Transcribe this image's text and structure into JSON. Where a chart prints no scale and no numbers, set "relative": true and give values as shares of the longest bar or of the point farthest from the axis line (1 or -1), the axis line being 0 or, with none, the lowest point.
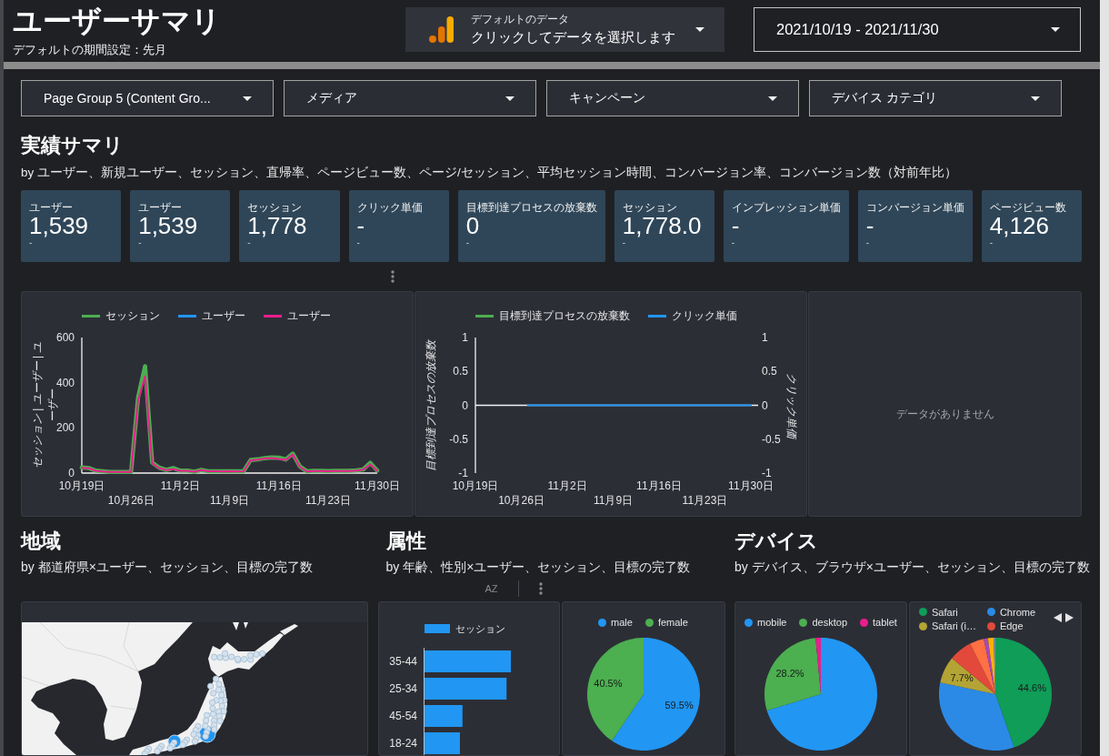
{
  "header": {
    "title": "ユーザーサマリ",
    "subtitle": "デフォルトの期間設定：先月",
    "data_source": {
      "caption": "デフォルトのデータ",
      "label": "クリックしてデータを選択します"
    },
    "date_range": "2021/10/19 - 2021/11/30"
  },
  "filters": [
    {
      "label": "Page Group 5 (Content Gro..."
    },
    {
      "label": "メディア"
    },
    {
      "label": "キャンペーン"
    },
    {
      "label": "デバイス カテゴリ"
    }
  ],
  "summary": {
    "title": "実績サマリ",
    "subtitle": "by ユーザー、新規ユーザー、セッション、直帰率、ページビュー数、ページ/セッション、平均セッション時間、コンバージョン率、コンバージョン数（対前年比）",
    "cards": [
      {
        "label": "ユーザー",
        "value": "1,539",
        "change": "-"
      },
      {
        "label": "ユーザー",
        "value": "1,539",
        "change": "-"
      },
      {
        "label": "セッション",
        "value": "1,778",
        "change": "-"
      },
      {
        "label": "クリック単価",
        "value": "-",
        "change": "-"
      },
      {
        "label": "目標到達プロセスの放棄数",
        "value": "0",
        "change": "-"
      },
      {
        "label": "セッション",
        "value": "1,778.0",
        "change": "-"
      },
      {
        "label": "インプレッション単価",
        "value": "-",
        "change": "-"
      },
      {
        "label": "コンバージョン単価",
        "value": "-",
        "change": "-"
      },
      {
        "label": "ページビュー数",
        "value": "4,126",
        "change": "-"
      }
    ]
  },
  "charts": [
    {
      "kind": "chart",
      "chart_data": {
        "type": "line",
        "legend": "top",
        "ylabel": "セッション | ユーザー | ユーザー",
        "categories": [
          "10月19日",
          null,
          null,
          null,
          null,
          null,
          null,
          "10月26日",
          null,
          null,
          null,
          null,
          null,
          null,
          "11月2日",
          null,
          null,
          null,
          null,
          null,
          null,
          "11月9日",
          null,
          null,
          null,
          null,
          null,
          null,
          "11月16日",
          null,
          null,
          null,
          null,
          null,
          null,
          "11月23日",
          null,
          null,
          null,
          null,
          null,
          null,
          "11月30日"
        ],
        "ylim": [
          0,
          600
        ],
        "yticks": [
          {
            "value": 0,
            "label": "0"
          },
          {
            "value": 200,
            "label": "200"
          },
          {
            "value": 400,
            "label": "400"
          },
          {
            "value": 600,
            "label": "600"
          }
        ],
        "series": [
          {
            "name": "セッション",
            "color": "#4caf50",
            "values": [
              25,
              22,
              11,
              8,
              5,
              5,
              5,
              5,
              335,
              473,
              47,
              24,
              14,
              22,
              11,
              11,
              6,
              14,
              8,
              8,
              8,
              8,
              8,
              8,
              58,
              61,
              66,
              69,
              68,
              60,
              86,
              30,
              8,
              10,
              10,
              9,
              10,
              10,
              10,
              12,
              16,
              45,
              11
            ]
          },
          {
            "name": "ユーザー",
            "color": "#2196f3",
            "values": [
              null,
              null,
              null,
              null,
              null,
              null,
              null,
              null,
              null,
              null,
              null,
              null,
              null,
              null,
              null,
              null,
              null,
              null,
              null,
              null,
              null,
              null,
              null,
              null,
              null,
              null,
              null,
              null,
              null,
              null,
              null,
              null,
              null,
              null,
              null,
              null,
              null,
              null,
              null,
              null,
              null,
              null,
              null
            ]
          },
          {
            "name": "ユーザー",
            "color": "#e91e8c",
            "values": [
              23,
              21,
              10,
              7,
              5,
              5,
              5,
              5,
              322,
              428,
              44,
              22,
              13,
              17,
              10,
              10,
              6,
              13,
              8,
              8,
              7,
              8,
              7,
              8,
              56,
              59,
              64,
              67,
              62,
              58,
              82,
              28,
              7,
              9,
              9,
              8,
              9,
              9,
              9,
              11,
              15,
              38,
              10
            ]
          }
        ]
      }
    },
    {
      "kind": "chart",
      "right_axis": {
        "title": "クリック単価",
        "ticks": [
          "1",
          "0.5",
          "0",
          "-0.5",
          "-1"
        ]
      },
      "chart_data": {
        "type": "line",
        "legend": "top",
        "ylabel": "目標到達プロセスの放棄数",
        "categories": [
          "10月19日",
          null,
          null,
          null,
          null,
          null,
          null,
          "10月26日",
          null,
          null,
          null,
          null,
          null,
          null,
          "11月2日",
          null,
          null,
          null,
          null,
          null,
          null,
          "11月9日",
          null,
          null,
          null,
          null,
          null,
          null,
          "11月16日",
          null,
          null,
          null,
          null,
          null,
          null,
          "11月23日",
          null,
          null,
          null,
          null,
          null,
          null,
          "11月30日"
        ],
        "ylim": [
          -1,
          1
        ],
        "yticks": [
          {
            "value": -1,
            "label": "-1"
          },
          {
            "value": -0.5,
            "label": "-0.5"
          },
          {
            "value": 0,
            "label": "0"
          },
          {
            "value": 0.5,
            "label": "0.5"
          },
          {
            "value": 1,
            "label": "1"
          }
        ],
        "series": [
          {
            "name": "目標到達プロセスの放棄数",
            "color": "#4caf50",
            "values": [
              null,
              null,
              null,
              null,
              null,
              null,
              null,
              null,
              null,
              null,
              null,
              null,
              null,
              null,
              null,
              null,
              null,
              null,
              null,
              null,
              null,
              null,
              null,
              null,
              null,
              null,
              null,
              null,
              null,
              null,
              null,
              null,
              null,
              null,
              null,
              null,
              null,
              null,
              null,
              null,
              null,
              null,
              null
            ]
          },
          {
            "name": "クリック単価",
            "color": "#2196f3",
            "values": [
              null,
              null,
              null,
              null,
              null,
              null,
              null,
              null,
              0,
              0,
              0,
              0,
              0,
              0,
              0,
              0,
              0,
              0,
              0,
              0,
              0,
              0,
              0,
              0,
              0,
              0,
              0,
              0,
              0,
              0,
              0,
              0,
              0,
              0,
              0,
              0,
              0,
              0,
              0,
              0,
              0,
              0,
              0
            ]
          }
        ]
      }
    },
    {
      "kind": "empty",
      "message": "データがありません"
    }
  ],
  "sections": [
    {
      "title": "地域",
      "subtitle": "by 都道府県×ユーザー、セッション、目標の完了数",
      "panels": [
        {
          "kind": "map",
          "paged": false
        }
      ]
    },
    {
      "title": "属性",
      "subtitle": "by 年齢、性別×ユーザー、セッション、目標の完了数",
      "toolbar": {
        "sort_label": "AZ"
      },
      "panels": [
        {
          "kind": "chart",
          "paged": false,
          "chart_data": {
            "type": "bar",
            "orientation": "horizontal",
            "legend": "top",
            "relative": true,
            "categories": [
              "35-44",
              "25-34",
              "45-54",
              "18-24"
            ],
            "series": [
              {
                "name": "セッション",
                "color": "#2196f3",
                "values": [
                  1,
                  0.95,
                  0.44,
                  0.41
                ]
              }
            ]
          }
        },
        {
          "kind": "chart",
          "paged": false,
          "chart_data": {
            "type": "pie",
            "legend": "top",
            "categories": [
              "male",
              "female"
            ],
            "values": [
              59.5,
              40.5
            ],
            "colors": [
              "#2196f3",
              "#4caf50"
            ],
            "value_labels": [
              "59.5%",
              "40.5%"
            ]
          }
        }
      ]
    },
    {
      "title": "デバイス",
      "subtitle": "by デバイス、ブラウザ×ユーザー、セッション、目標の完了数",
      "panels": [
        {
          "kind": "chart",
          "paged": false,
          "chart_data": {
            "type": "pie",
            "legend": "top",
            "categories": [
              "mobile",
              "desktop",
              "tablet"
            ],
            "values": [
              70.3,
              28.2,
              1.5
            ],
            "colors": [
              "#2196f3",
              "#4caf50",
              "#e91e8c"
            ],
            "value_labels": [
              null,
              "28.2%",
              null
            ]
          }
        },
        {
          "kind": "chart",
          "paged": true,
          "legend_labels": [
            "Safari",
            "Chrome",
            "Safari (i…",
            "Edge"
          ],
          "chart_data": {
            "type": "pie",
            "values": [
              44.6,
              33.7,
              7.7,
              6.6,
              4.1,
              1.2,
              1.6,
              0.5
            ],
            "colors": [
              "#0f9d58",
              "#2b8ae6",
              "#b3a435",
              "#e2493b",
              "#ff7043",
              "#ab47bc",
              "#f9b300",
              "#78909c"
            ],
            "value_labels": [
              "44.6%",
              null,
              "7.7%",
              null,
              null,
              null,
              null,
              null
            ]
          }
        }
      ]
    }
  ]
}
